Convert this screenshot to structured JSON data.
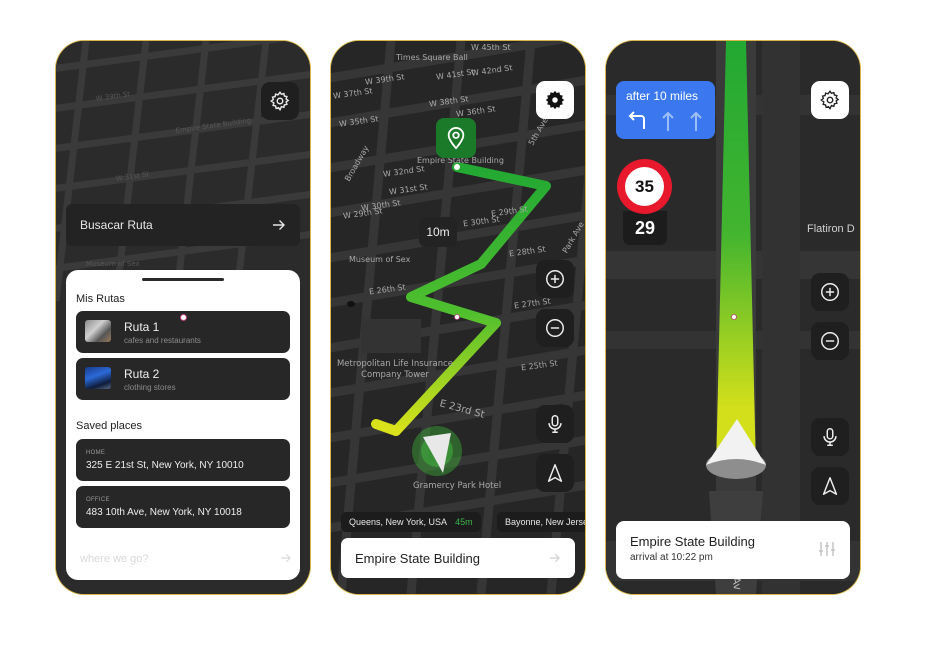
{
  "screen1": {
    "search_label": "Busacar Ruta",
    "my_routes_title": "Mis Rutas",
    "routes": [
      {
        "name": "Ruta 1",
        "subtitle": "cafes and restaurants"
      },
      {
        "name": "Ruta 2",
        "subtitle": "clothing stores"
      }
    ],
    "saved_title": "Saved places",
    "places": [
      {
        "label": "HOME",
        "address": "325 E 21st St, New York, NY 10010"
      },
      {
        "label": "OFFICE",
        "address": "483 10th Ave, New York, NY 10018"
      }
    ],
    "bottom_placeholder": "where we go?"
  },
  "screen2": {
    "distance_badge": "10m",
    "destination_pin_label": "Empire State Building",
    "start_label": "Gramercy Park Hotel",
    "landmark_labels": [
      "Metropolitan Life Insurance Company Tower",
      "Museum of Sex",
      "Times Square Ball",
      "Broadway",
      "Park Ave",
      "5th Ave"
    ],
    "street_labels": [
      "W 45th St",
      "W 42nd St",
      "W 41st St",
      "W 39th St",
      "W 38th St",
      "W 37th St",
      "W 36th St",
      "W 35th St",
      "W 32nd St",
      "W 31st St",
      "W 30th St",
      "W 29th St",
      "E 30th St",
      "E 29th St",
      "E 28th St",
      "E 26th St",
      "E 27th St",
      "E 25th St",
      "E 23rd St"
    ],
    "chips": [
      {
        "place": "Queens, New York, USA",
        "time": "45m"
      },
      {
        "place": "Bayonne, New Jersey",
        "time": ""
      }
    ],
    "destination_bar": "Empire State Building"
  },
  "screen3": {
    "turn_text": "after 10 miles",
    "speed_limit": "35",
    "current_speed": "29",
    "map_place_label": "Flatiron D",
    "street_vertical_label": "Av",
    "destination": "Empire State Building",
    "arrival": "arrival at 10:22 pm"
  },
  "colors": {
    "route_green": "#22a833",
    "route_yellow": "#d9e21a",
    "turn_blue": "#3b78f0",
    "speed_red": "#e8192c",
    "chip_time_green": "#39b54a"
  }
}
